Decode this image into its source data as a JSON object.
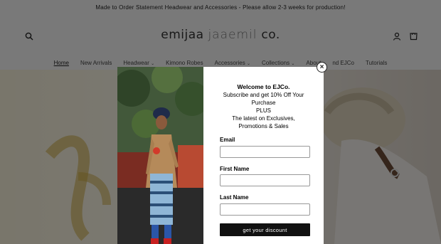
{
  "announcement": "Made to Order Statement Headwear and Accessories - Please allow 2-3 weeks for production!",
  "header": {
    "logo_main": "emijaa",
    "logo_ghost": "jaaemil",
    "logo_suffix": "co."
  },
  "nav": {
    "items": [
      {
        "label": "Home",
        "active": true
      },
      {
        "label": "New Arrivals"
      },
      {
        "label": "Headwear",
        "dropdown": true
      },
      {
        "label": "Kimono Robes"
      },
      {
        "label": "Accessories",
        "dropdown": true
      },
      {
        "label": "Collections",
        "dropdown": true
      },
      {
        "label": "About"
      },
      {
        "label": "nd EJCo"
      },
      {
        "label": "Tutorials"
      }
    ]
  },
  "popup": {
    "welcome": "Welcome to EJCo.",
    "line1": "Subscribe and get 10% Off Your",
    "line2": "Purchase",
    "line3": "PLUS",
    "line4": "The latest on Exclusives,",
    "line5": "Promotions & Sales",
    "email_label": "Email",
    "first_name_label": "First Name",
    "last_name_label": "Last Name",
    "button_label": "get your discount",
    "close_symbol": "×"
  },
  "colors": {
    "overlay": "#000000",
    "button": "#111111"
  }
}
